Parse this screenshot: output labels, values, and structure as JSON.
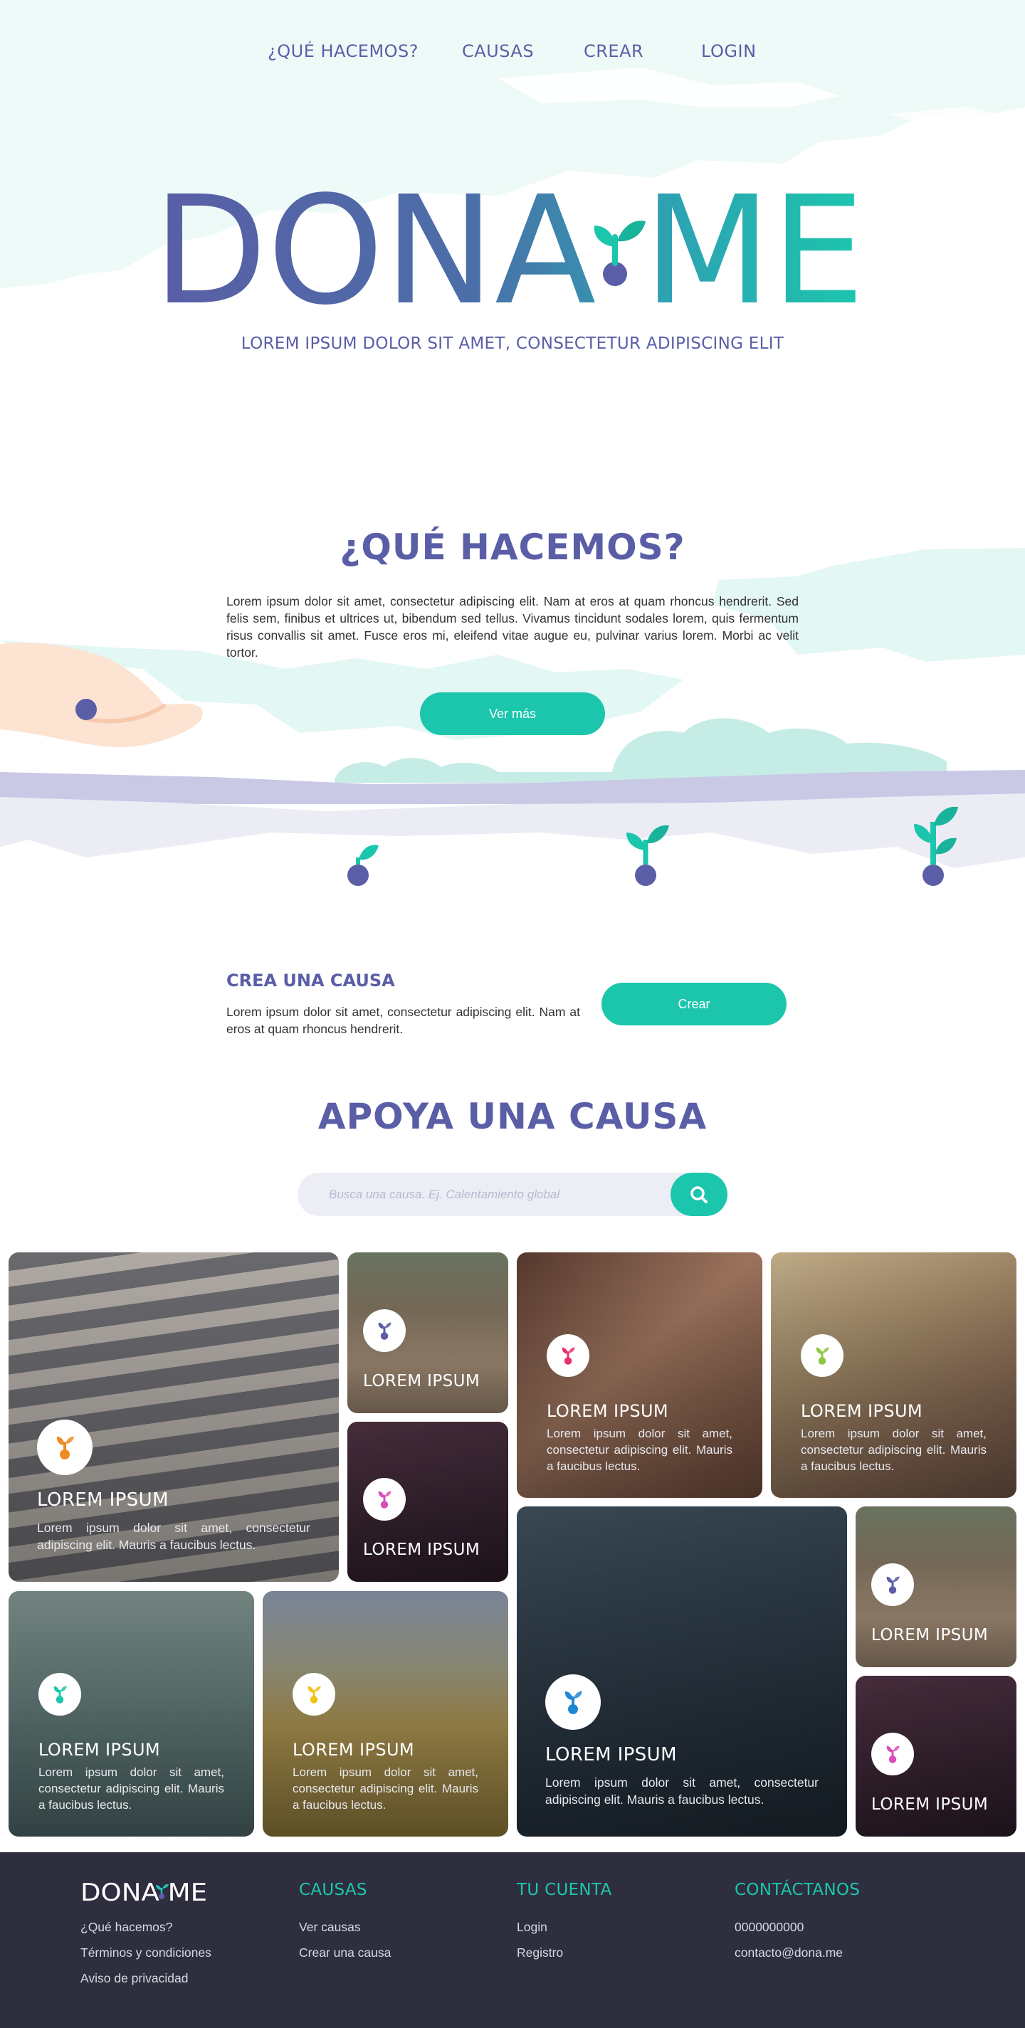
{
  "nav": {
    "items": [
      "¿QUÉ HACEMOS?",
      "CAUSAS",
      "CREAR",
      "LOGIN"
    ]
  },
  "hero": {
    "logo_text": "DONA·ME",
    "tagline": "LOREM IPSUM DOLOR SIT AMET, CONSECTETUR ADIPISCING ELIT"
  },
  "what": {
    "title": "¿QUÉ HACEMOS?",
    "text": "Lorem ipsum dolor sit amet, consectetur adipiscing elit. Nam at eros at quam rhoncus hendrerit. Sed felis sem, finibus et ultrices ut, bibendum sed tellus. Vivamus tincidunt sodales lorem, quis fermentum risus convallis sit amet. Fusce eros mi, eleifend vitae augue eu, pulvinar varius lorem. Morbi ac velit tortor.",
    "button": "Ver más"
  },
  "crea": {
    "title": "CREA UNA CAUSA",
    "text": "Lorem ipsum dolor sit amet, consectetur adipiscing elit. Nam at eros at quam rhoncus hendrerit.",
    "button": "Crear"
  },
  "apoya": {
    "title": "APOYA UNA CAUSA",
    "search_placeholder": "Busca una causa. Ej. Calentamiento global",
    "search_icon": "search-icon"
  },
  "cards": [
    {
      "title": "LOREM IPSUM",
      "text": "Lorem ipsum dolor sit amet, consectetur adipiscing elit. Mauris a faucibus lectus.",
      "color": "#f08a24",
      "photo": "pregnant-woman"
    },
    {
      "title": "LOREM IPSUM",
      "text": "",
      "color": "#5a5ea6",
      "photo": "family-walking"
    },
    {
      "title": "LOREM IPSUM",
      "text": "",
      "color": "#d94fb8",
      "photo": "piano-keys"
    },
    {
      "title": "LOREM IPSUM",
      "text": "Lorem ipsum dolor sit amet, consectetur adipiscing elit. Mauris a faucibus lectus.",
      "color": "#e8326e",
      "photo": "old-photographs"
    },
    {
      "title": "LOREM IPSUM",
      "text": "Lorem ipsum dolor sit amet, consectetur adipiscing elit. Mauris a faucibus lectus.",
      "color": "#8dc63f",
      "photo": "child-with-dog"
    },
    {
      "title": "LOREM IPSUM",
      "text": "Lorem ipsum dolor sit amet, consectetur adipiscing elit. Mauris a faucibus lectus.",
      "color": "#1cc6ad",
      "photo": "lake-pier"
    },
    {
      "title": "LOREM IPSUM",
      "text": "Lorem ipsum dolor sit amet, consectetur adipiscing elit. Mauris a faucibus lectus.",
      "color": "#f2c318",
      "photo": "elephants-savanna"
    },
    {
      "title": "LOREM IPSUM",
      "text": "Lorem ipsum dolor sit amet, consectetur adipiscing elit. Mauris a faucibus lectus.",
      "color": "#1e88d6",
      "photo": "girl-at-window"
    },
    {
      "title": "LOREM IPSUM",
      "text": "",
      "color": "#5a5ea6",
      "photo": "family-walking"
    },
    {
      "title": "LOREM IPSUM",
      "text": "",
      "color": "#d94fb8",
      "photo": "piano-keys"
    }
  ],
  "footer": {
    "logo_text": "DONA·ME",
    "col1": [
      "¿Qué hacemos?",
      "Términos y condiciones",
      "Aviso de privacidad"
    ],
    "col2_title": "CAUSAS",
    "col2": [
      "Ver causas",
      "Crear una causa"
    ],
    "col3_title": "TU CUENTA",
    "col3": [
      "Login",
      "Registro"
    ],
    "col4_title": "CONTÁCTANOS",
    "col4": [
      "0000000000",
      "contacto@dona.me"
    ]
  },
  "colors": {
    "brand_purple": "#5a5ea6",
    "brand_teal": "#1cc6ad",
    "footer_bg": "#2e2e3e",
    "sky": "#eefaf8"
  }
}
